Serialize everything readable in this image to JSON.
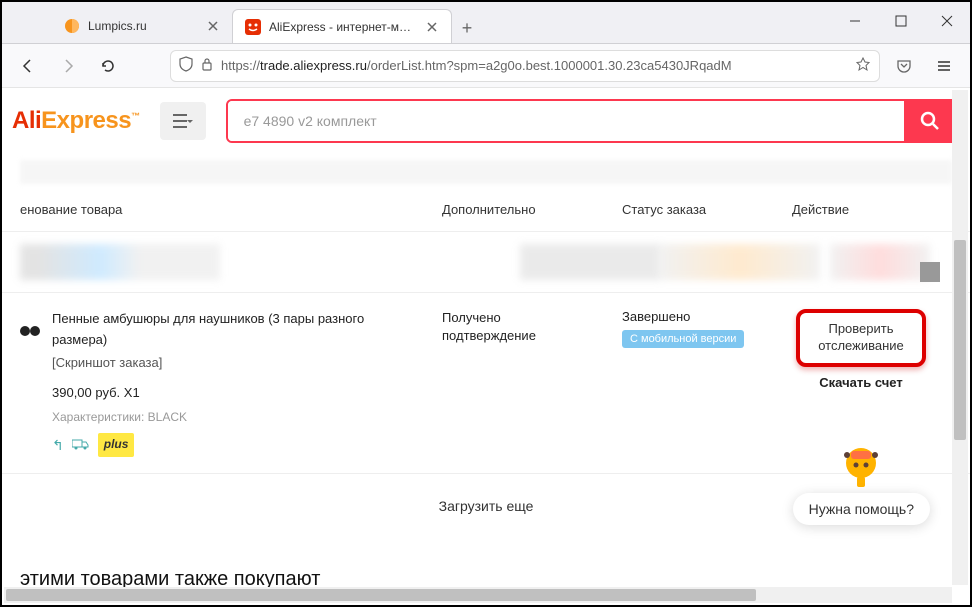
{
  "browser": {
    "tabs": [
      {
        "title": "Lumpics.ru"
      },
      {
        "title": "AliExpress - интернет-магазин"
      }
    ],
    "url_prefix": "https://",
    "url_host": "trade.aliexpress.ru",
    "url_path": "/orderList.htm?spm=a2g0o.best.1000001.30.23ca5430JRqadM"
  },
  "header": {
    "logo_ali": "Ali",
    "logo_exp": "Express",
    "search_value": "e7 4890 v2 комплект"
  },
  "columns": {
    "name": "енование товара",
    "extra": "Дополнительно",
    "status": "Статус заказа",
    "action": "Действие"
  },
  "order": {
    "title": "Пенные амбушюры для наушников (3 пары разного размера)",
    "snapshot": "[Скриншот заказа]",
    "price": "390,00 руб. X1",
    "chars": "Характеристики: BLACK",
    "plus": "plus",
    "extra_line1": "Получено",
    "extra_line2": "подтверждение",
    "status_text": "Завершено",
    "mobile_badge": "С мобильной версии",
    "track_line1": "Проверить",
    "track_line2": "отслеживание",
    "invoice": "Скачать счет"
  },
  "load_more": "Загрузить еще",
  "also_buy": "этими товарами также покупают",
  "help": "Нужна помощь?"
}
